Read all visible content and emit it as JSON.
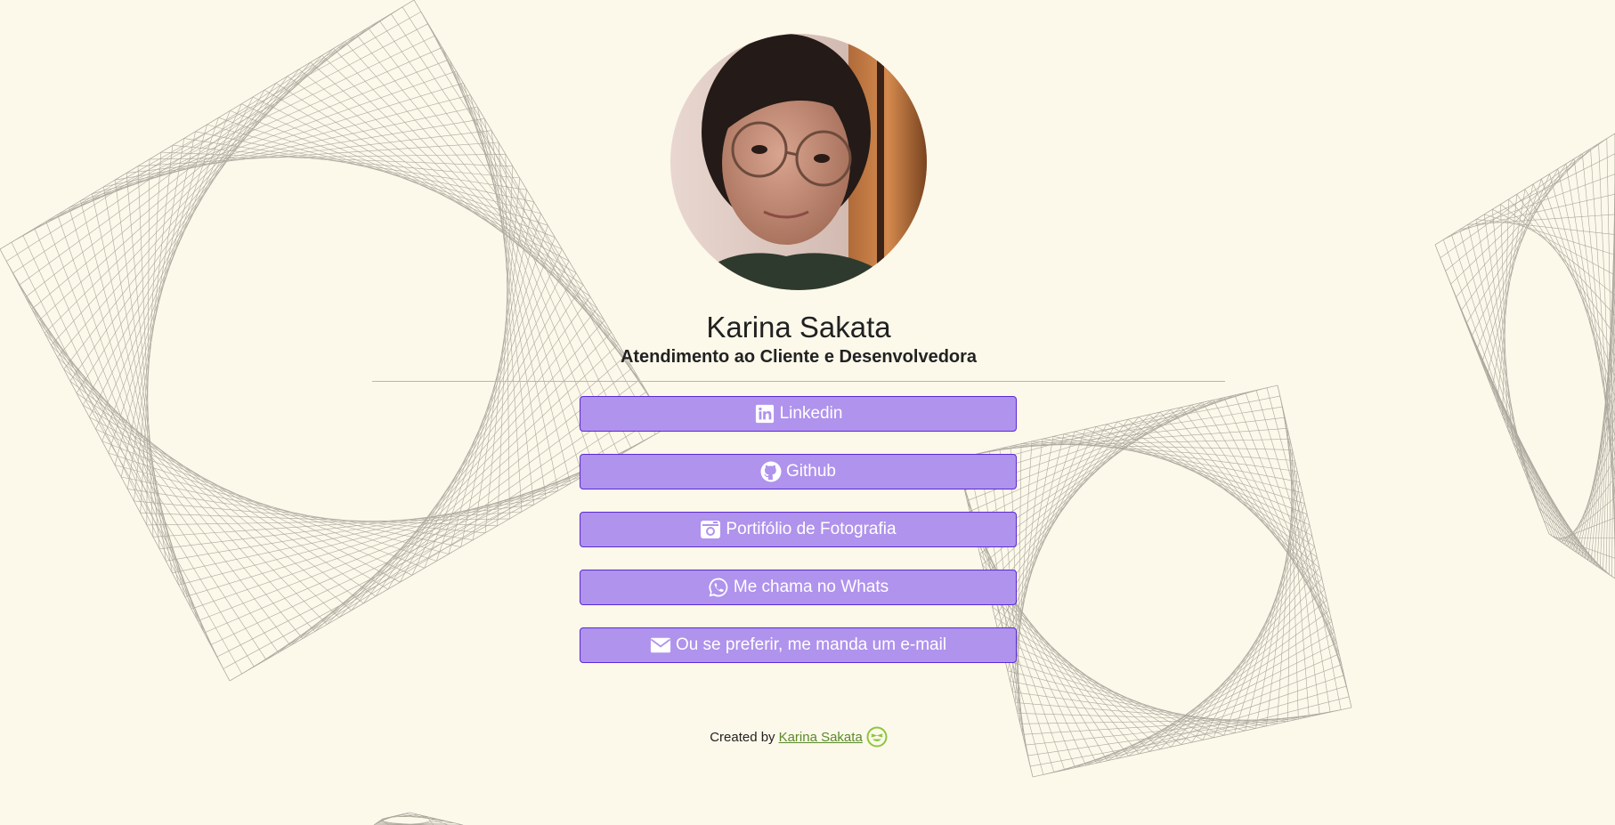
{
  "profile": {
    "name": "Karina Sakata",
    "role": "Atendimento ao Cliente e Desenvolvedora",
    "avatar_alt": "profile-photo"
  },
  "links": [
    {
      "label": "Linkedin",
      "icon": "linkedin-icon"
    },
    {
      "label": "Github",
      "icon": "github-icon"
    },
    {
      "label": "Portifólio de Fotografia",
      "icon": "camera-icon"
    },
    {
      "label": "Me chama no Whats",
      "icon": "whatsapp-icon"
    },
    {
      "label": "Ou se preferir, me manda um e-mail",
      "icon": "envelope-icon"
    }
  ],
  "footer": {
    "prefix": "Created by",
    "author_link": "Karina Sakata",
    "emoji_icon": "smile-wink-icon"
  },
  "colors": {
    "background": "#fcf8ea",
    "button_fill": "#b093ec",
    "button_border": "#5b2ad6",
    "link": "#5a8a2a"
  }
}
